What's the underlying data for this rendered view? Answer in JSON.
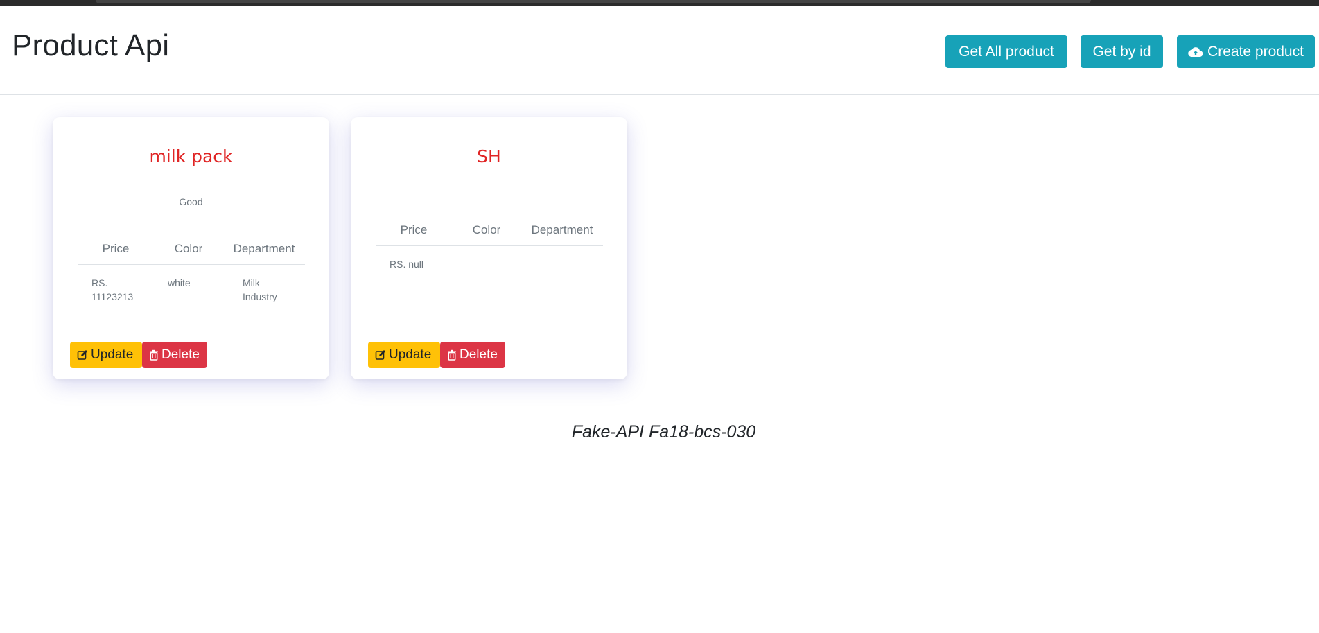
{
  "header": {
    "title": "Product Api",
    "buttons": {
      "get_all": "Get All product",
      "get_by_id": "Get by id",
      "create": "Create product"
    }
  },
  "products": [
    {
      "name": "milk pack",
      "description": "Good",
      "columns": [
        "Price",
        "Color",
        "Department"
      ],
      "price": "RS. 11123213",
      "color": "white",
      "department": "Milk Industry",
      "update_label": "Update",
      "delete_label": "Delete"
    },
    {
      "name": "SH",
      "description": "",
      "columns": [
        "Price",
        "Color",
        "Department"
      ],
      "price": "RS. null",
      "color": "",
      "department": "",
      "update_label": "Update",
      "delete_label": "Delete"
    }
  ],
  "footer": {
    "text": "Fake-API Fa18-bcs-030"
  },
  "colors": {
    "info": "#17a2b8",
    "warning": "#ffc107",
    "danger": "#dc3545",
    "title_red": "#e02424"
  },
  "icons": {
    "create": "cloud-upload-icon",
    "update": "edit-icon",
    "delete": "trash-icon"
  }
}
